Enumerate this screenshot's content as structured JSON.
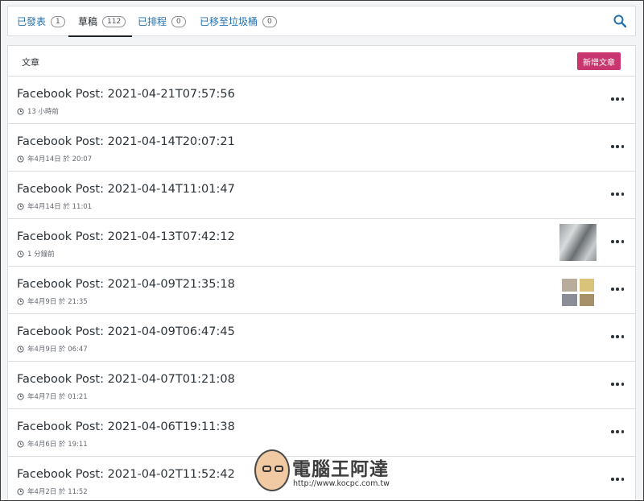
{
  "tabs": [
    {
      "label": "已發表",
      "count": "1"
    },
    {
      "label": "草稿",
      "count": "112"
    },
    {
      "label": "已排程",
      "count": "0"
    },
    {
      "label": "已移至垃圾桶",
      "count": "0"
    }
  ],
  "active_tab": "草稿",
  "panel": {
    "title": "文章",
    "new_post_label": "新增文章"
  },
  "posts": [
    {
      "title": "Facebook Post: 2021-04-21T07:57:56",
      "meta": "13 小時前"
    },
    {
      "title": "Facebook Post: 2021-04-14T20:07:21",
      "meta": "年4月14日 於 20:07"
    },
    {
      "title": "Facebook Post: 2021-04-14T11:01:47",
      "meta": "年4月14日 於 11:01"
    },
    {
      "title": "Facebook Post: 2021-04-13T07:42:12",
      "meta": "1 分鐘前"
    },
    {
      "title": "Facebook Post: 2021-04-09T21:35:18",
      "meta": "年4月9日 於 21:35"
    },
    {
      "title": "Facebook Post: 2021-04-09T06:47:45",
      "meta": "年4月9日 於 06:47"
    },
    {
      "title": "Facebook Post: 2021-04-07T01:21:08",
      "meta": "年4月7日 於 01:21"
    },
    {
      "title": "Facebook Post: 2021-04-06T19:11:38",
      "meta": "年4月6日 於 19:11"
    },
    {
      "title": "Facebook Post: 2021-04-02T11:52:42",
      "meta": "年4月2日 於 11:52"
    }
  ],
  "watermark": {
    "title": "電腦王阿達",
    "url": "http://www.kocpc.com.tw"
  },
  "colors": {
    "accent": "#c9356e",
    "link": "#2271b1"
  },
  "icons": {
    "search": "search-icon",
    "clock": "clock-icon",
    "more": "ellipsis-icon"
  }
}
